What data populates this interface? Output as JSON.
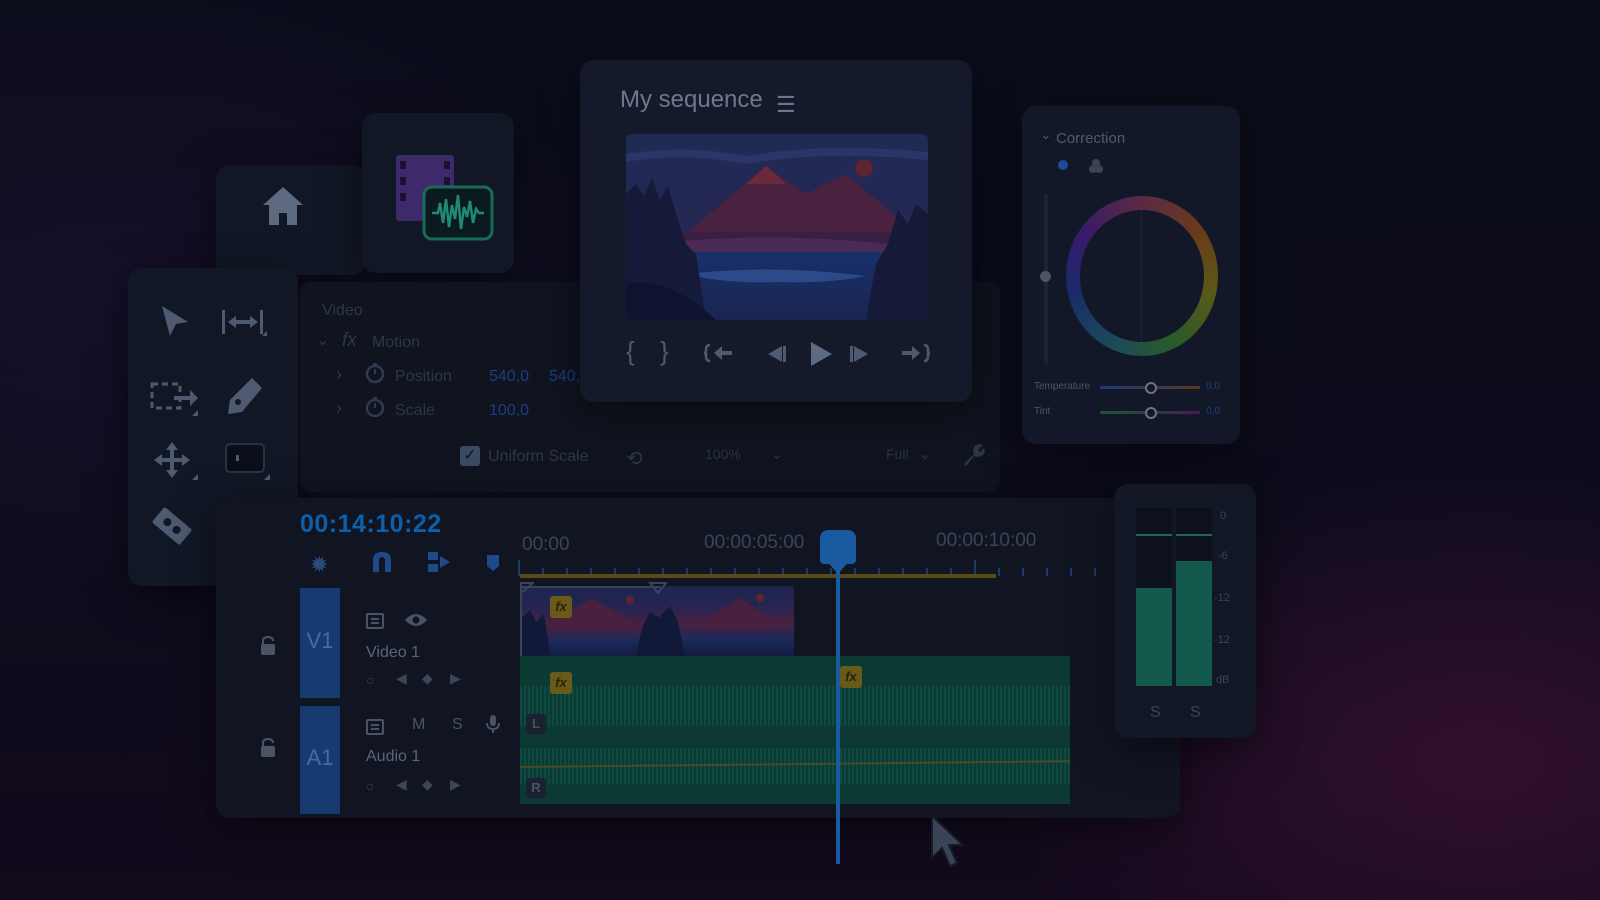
{
  "program_monitor": {
    "title": "My sequence",
    "menu_icon": "hamburger-menu-icon",
    "transport_icons": [
      "mark-in-icon",
      "mark-out-icon",
      "go-to-in-icon",
      "step-back-icon",
      "play-icon",
      "step-forward-icon",
      "go-to-out-icon"
    ]
  },
  "effect_controls": {
    "section": "Video",
    "effect_name": "Motion",
    "position_label": "Position",
    "position_x": "540,0",
    "position_y": "540,",
    "scale_label": "Scale",
    "scale_value": "100,0",
    "uniform_scale_label": "Uniform Scale",
    "zoom_value": "100%",
    "quality_value": "Full"
  },
  "correction": {
    "title": "Correction",
    "temperature_label": "Temperature",
    "temperature_value": "0,0",
    "tint_label": "Tint",
    "tint_value": "0,0"
  },
  "timeline": {
    "timecode": "00:14:10:22",
    "ruler_labels": [
      "00:00",
      "00:00:05:00",
      "00:00:10:00"
    ],
    "video_track_tag": "V1",
    "video_track_name": "Video 1",
    "audio_track_tag": "A1",
    "audio_track_name": "Audio 1",
    "mute_label": "M",
    "solo_label": "S",
    "left_channel": "L",
    "right_channel": "R",
    "fx_label": "fx"
  },
  "meter": {
    "scale": [
      "0",
      "-6",
      "-12",
      "-12",
      "dB"
    ],
    "solo_labels": [
      "S",
      "S"
    ],
    "left_level": 0.55,
    "right_level": 0.7
  },
  "colors": {
    "accent": "#0c5fa8",
    "audio": "#0f4a40",
    "track_tag": "#173a70",
    "fx": "#6a5a1a"
  }
}
